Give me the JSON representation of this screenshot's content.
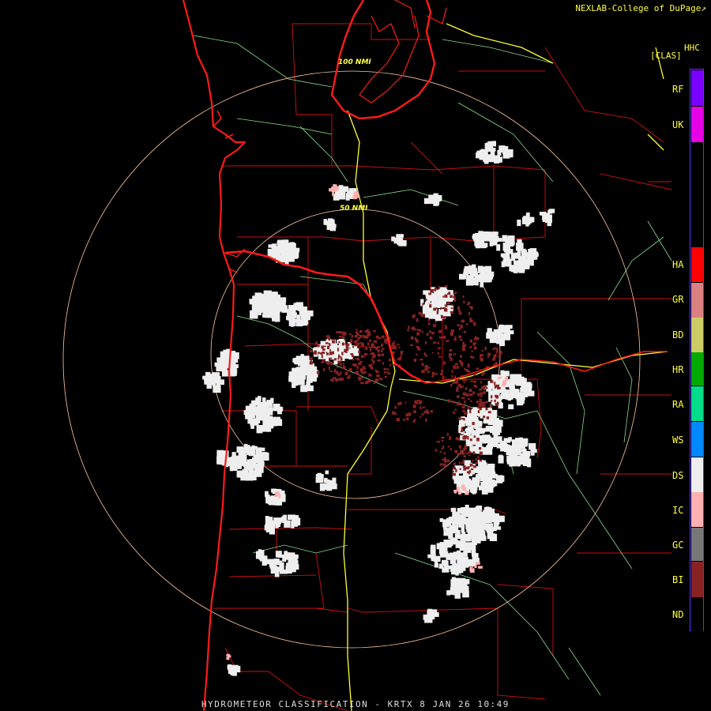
{
  "header": {
    "credit": "NEXLAB-College of DuPage",
    "credit_mark": "↗"
  },
  "product": {
    "code": "HHC",
    "class_label": "[CLAS]"
  },
  "range_rings": [
    {
      "label": "100 NMI"
    },
    {
      "label": "50 NMI"
    }
  ],
  "legend": {
    "items": [
      {
        "code": "RF",
        "color": "#7a00ff"
      },
      {
        "code": "UK",
        "color": "#e600e6"
      },
      {
        "code": "HA",
        "color": "#ff0000"
      },
      {
        "code": "GR",
        "color": "#d98080"
      },
      {
        "code": "BD",
        "color": "#cccc66"
      },
      {
        "code": "HR",
        "color": "#00aa00"
      },
      {
        "code": "RA",
        "color": "#00dd88"
      },
      {
        "code": "WS",
        "color": "#0088ff"
      },
      {
        "code": "DS",
        "color": "#eeeeee"
      },
      {
        "code": "IC",
        "color": "#ffb0b0"
      },
      {
        "code": "GC",
        "color": "#777777"
      },
      {
        "code": "BI",
        "color": "#882222"
      },
      {
        "code": "ND",
        "color": "#000000"
      }
    ]
  },
  "footer": {
    "caption": "HYDROMETEOR CLASSIFICATION - KRTX 8 JAN 26 10:49"
  },
  "colors": {
    "coastline": "#ff1a1a",
    "county_border": "#cc1111",
    "interstate": "#ffff33",
    "highway": "#88dd88",
    "range_ring": "#ffc8a0"
  }
}
